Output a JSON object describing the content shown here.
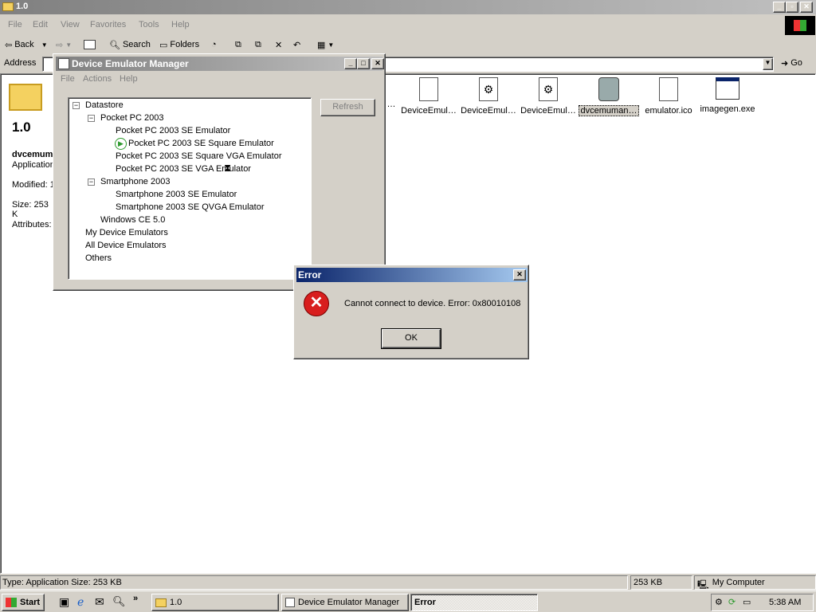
{
  "explorer": {
    "title": "1.0",
    "menu": [
      "File",
      "Edit",
      "View",
      "Favorites",
      "Tools",
      "Help"
    ],
    "toolbar": {
      "back": "Back",
      "search": "Search",
      "folders": "Folders"
    },
    "address_label": "Address",
    "go_label": "Go",
    "left_panel": {
      "folder_name": "1.0",
      "file_name": "dvcemum",
      "file_type": "Application",
      "modified": "Modified: 1",
      "size": "Size: 253 K",
      "attributes": "Attributes:"
    },
    "files": [
      {
        "name": "…",
        "icon": "dll-icon"
      },
      {
        "name": "DeviceEmul…",
        "icon": "dll-icon"
      },
      {
        "name": "DeviceEmul…",
        "icon": "gear-file-icon"
      },
      {
        "name": "DeviceEmul…",
        "icon": "gear-file-icon"
      },
      {
        "name": "dvcemuman…",
        "icon": "device-tool-icon"
      },
      {
        "name": "emulator.ico",
        "icon": "ico-file-icon"
      },
      {
        "name": "imagegen.exe",
        "icon": "exe-window-icon"
      }
    ],
    "status": {
      "left": "Type: Application Size: 253 KB",
      "size": "253 KB",
      "zone": "My Computer"
    }
  },
  "dem": {
    "title": "Device Emulator Manager",
    "menu": [
      "File",
      "Actions",
      "Help"
    ],
    "refresh_label": "Refresh",
    "tree": {
      "datastore": "Datastore",
      "ppc": "Pocket PC 2003",
      "ppc_items": [
        "Pocket PC 2003 SE Emulator",
        "Pocket PC 2003 SE Square Emulator",
        "Pocket PC 2003 SE Square VGA Emulator",
        "Pocket PC 2003 SE VGA Emulator"
      ],
      "sp": "Smartphone 2003",
      "sp_items": [
        "Smartphone 2003 SE Emulator",
        "Smartphone 2003 SE QVGA Emulator"
      ],
      "wince": "Windows CE 5.0",
      "my": "My Device Emulators",
      "all": "All Device Emulators",
      "others": "Others"
    }
  },
  "error": {
    "title": "Error",
    "message": "Cannot connect to device. Error: 0x80010108",
    "ok_label": "OK"
  },
  "taskbar": {
    "start": "Start",
    "tasks": [
      "1.0",
      "Device Emulator Manager",
      "Error"
    ],
    "clock": "5:38 AM"
  },
  "colors": {
    "title_active": "#0a246a",
    "title_gradient_end": "#a6caf0",
    "title_inactive": "#808080",
    "error_red": "#d81e1e",
    "run_green": "#2e9a2e"
  }
}
